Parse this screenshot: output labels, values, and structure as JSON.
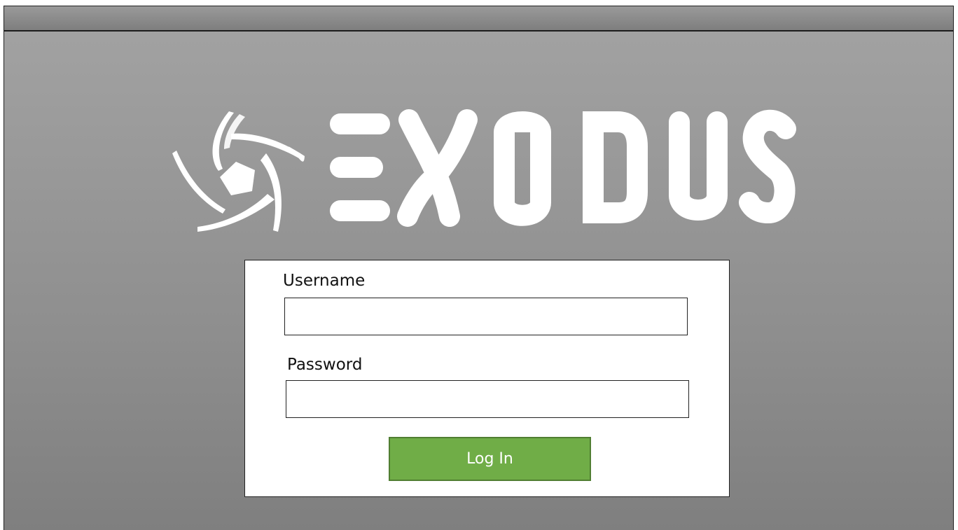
{
  "logo": {
    "brand_text": "EXODUS",
    "icon": "exodus-pentagon-swirl-icon"
  },
  "login": {
    "username_label": "Username",
    "username_value": "",
    "username_placeholder": "",
    "password_label": "Password",
    "password_value": "",
    "password_placeholder": "",
    "button_label": "Log In"
  },
  "colors": {
    "background": "#8f8f8f",
    "card": "#ffffff",
    "button": "#70ad47",
    "logo": "#ffffff"
  }
}
